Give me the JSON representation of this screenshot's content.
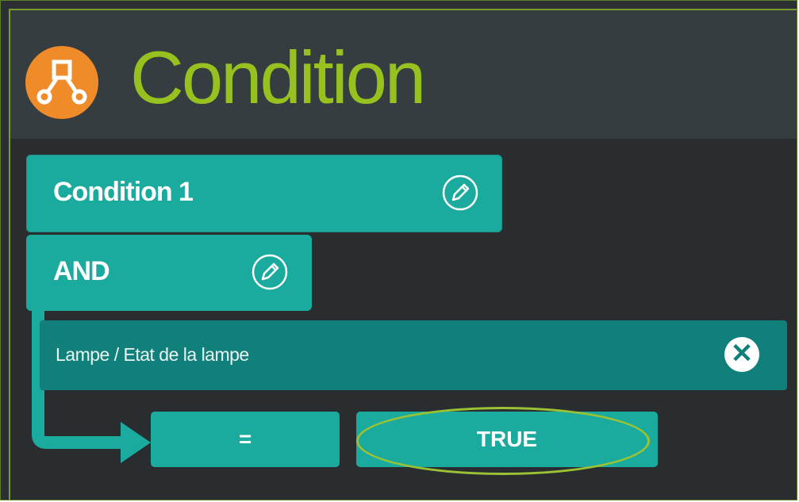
{
  "header": {
    "title": "Condition",
    "icon": "flow-diagram-icon"
  },
  "condition_block": {
    "label": "Condition 1",
    "edit_icon": "pencil-icon"
  },
  "operator_block": {
    "label": "AND",
    "edit_icon": "pencil-icon"
  },
  "device_row": {
    "label": "Lampe / Etat de la lampe",
    "remove_icon": "close-icon"
  },
  "comparison": {
    "operator": "=",
    "value": "TRUE"
  },
  "colors": {
    "accent_green": "#97c11f",
    "teal": "#1bab9e",
    "dark_teal": "#11807a",
    "logo_orange": "#f08b2a",
    "header_bg": "#353d40",
    "content_bg": "#2a2d2f"
  }
}
